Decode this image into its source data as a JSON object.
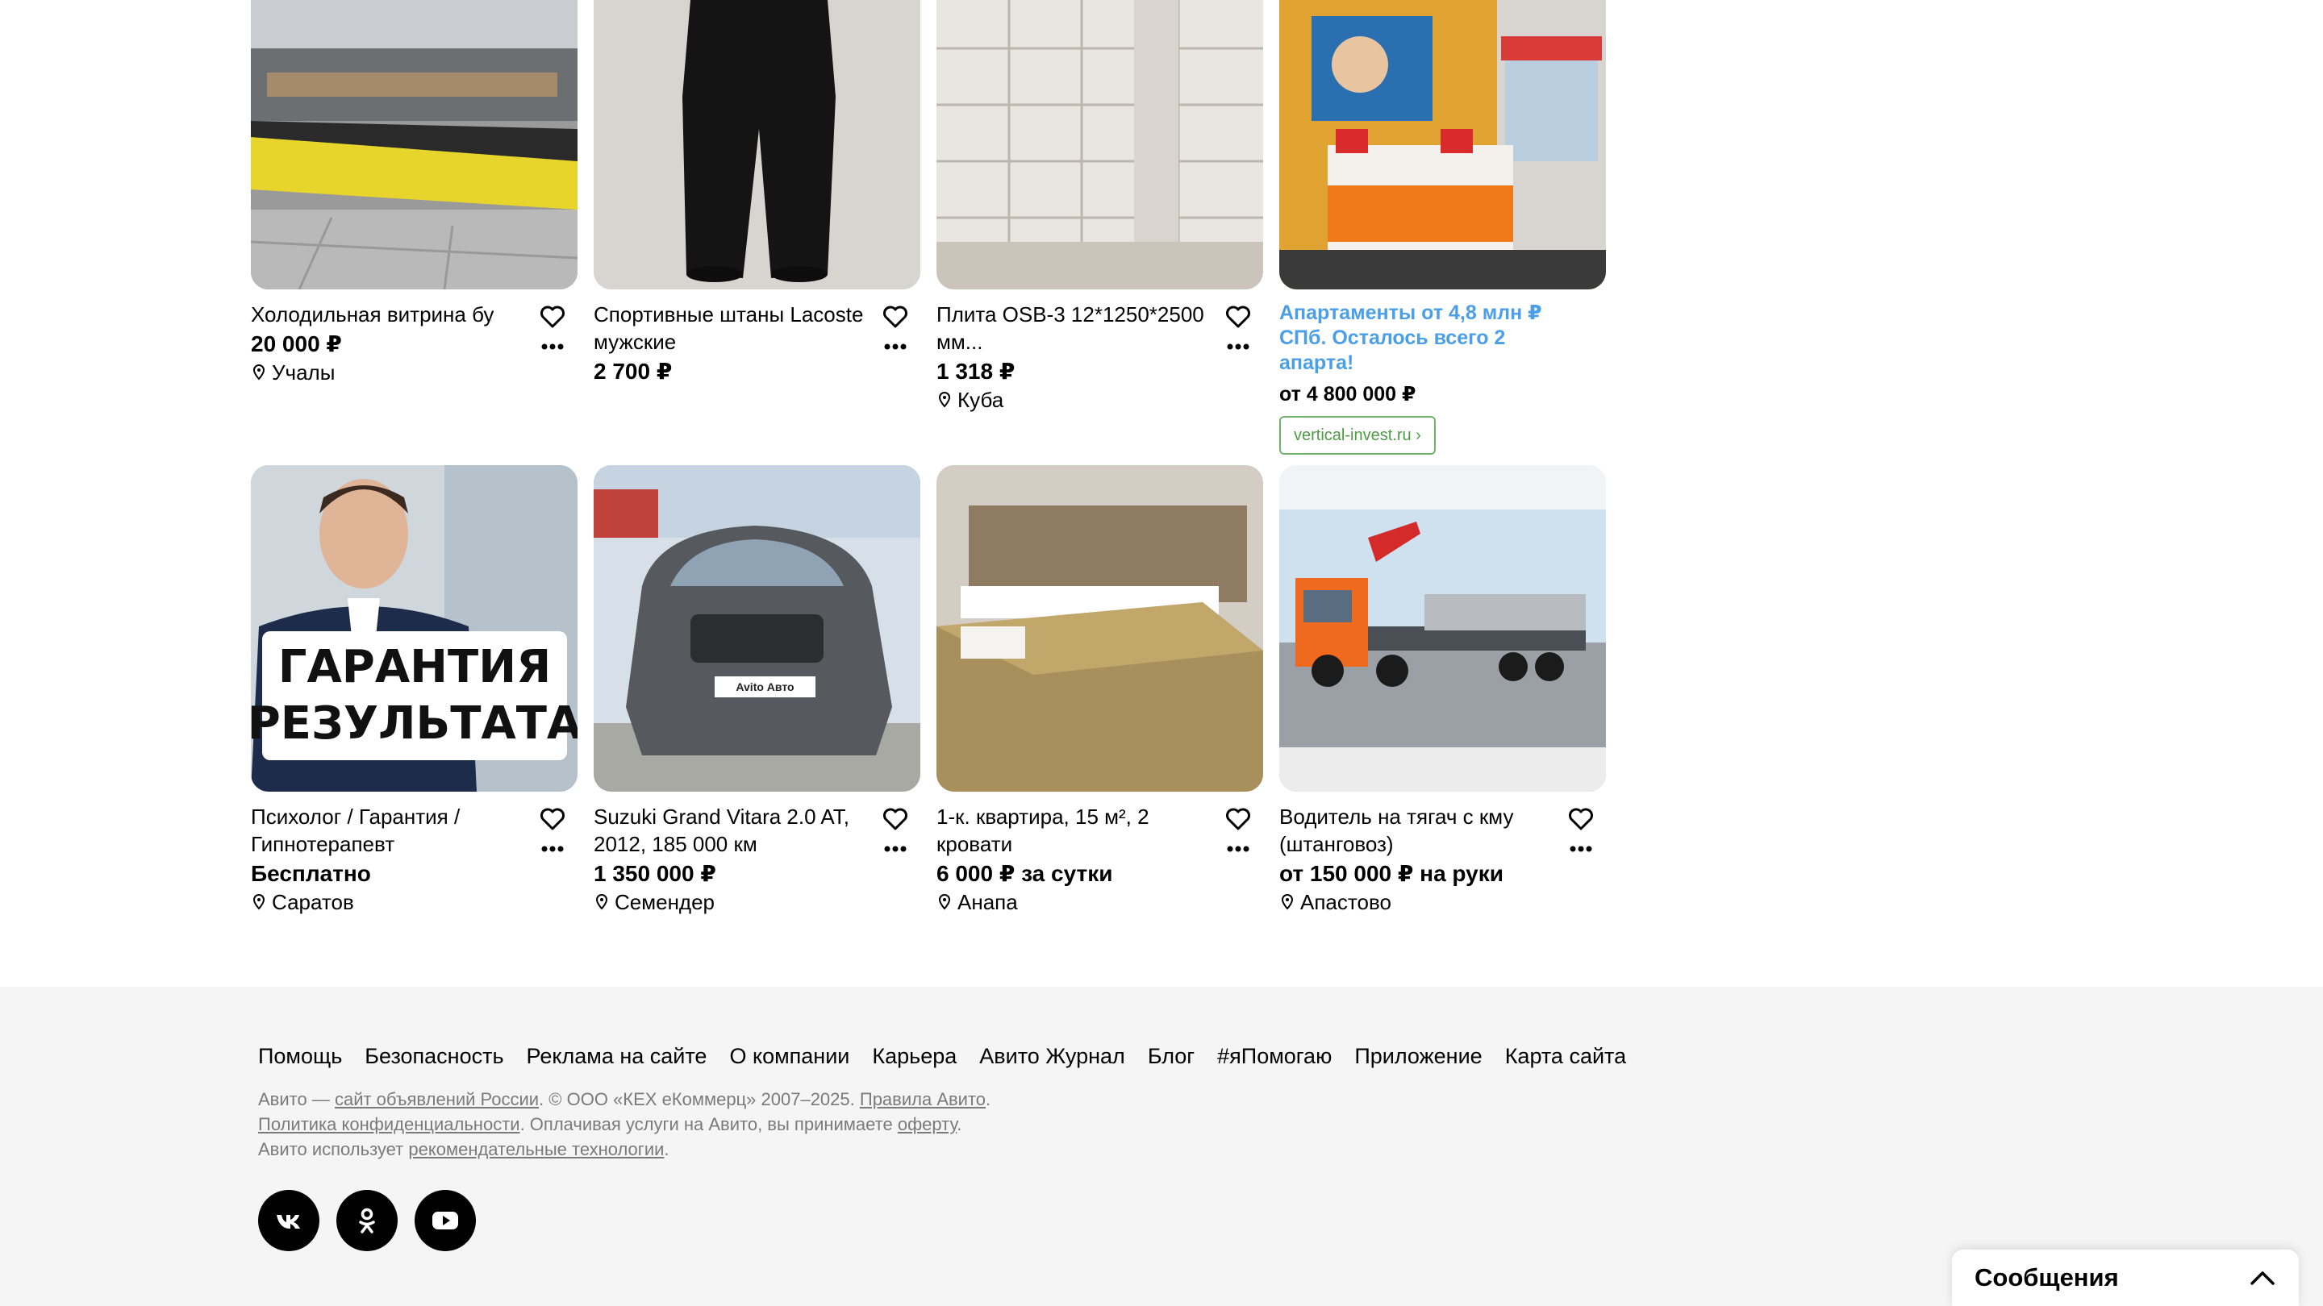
{
  "row1": [
    {
      "title": "Холодильная витрина бу",
      "price": "20 000 ₽",
      "location": "Учалы"
    },
    {
      "title": "Спортивные штаны Lacoste мужские",
      "price": "2 700 ₽",
      "location": ""
    },
    {
      "title": "Плита OSB-3 12*1250*2500 мм...",
      "price": "1 318 ₽",
      "location": "Куба"
    }
  ],
  "ad": {
    "title": "Апартаменты от 4,8 млн ₽ СПб. Осталось всего 2 апарта!",
    "price": "от 4 800 000 ₽",
    "link": "vertical-invest.ru ›"
  },
  "row2": [
    {
      "title": "Психолог / Гарантия / Гипнотерапевт",
      "price": "Бесплатно",
      "location": "Саратов",
      "image_text_line1": "ГАРАНТИЯ",
      "image_text_line2": "РЕЗУЛЬТАТА"
    },
    {
      "title": "Suzuki Grand Vitara 2.0 AT, 2012, 185 000 км",
      "price": "1 350 000 ₽",
      "location": "Семендер",
      "plate_text": "Avito Авто"
    },
    {
      "title": "1-к. квартира, 15 м², 2 кровати",
      "price": "6 000 ₽ за сутки",
      "location": "Анапа"
    },
    {
      "title": "Водитель на тягач с кму (штанговоз)",
      "price": "от 150 000 ₽ на руки",
      "location": "Апастово"
    }
  ],
  "footer": {
    "links": [
      "Помощь",
      "Безопасность",
      "Реклама на сайте",
      "О компании",
      "Карьера",
      "Авито Журнал",
      "Блог",
      "#яПомогаю",
      "Приложение",
      "Карта сайта"
    ],
    "legal": {
      "t1": "Авито — ",
      "l1": "сайт объявлений России",
      "t2": ". © ООО «КЕХ еКоммерц» 2007–2025. ",
      "l2": "Правила Авито",
      "t3": ".",
      "l3": "Политика конфиденциальности",
      "t4": ". Оплачивая услуги на Авито, вы принимаете ",
      "l4": "оферту",
      "t5": ".",
      "t6": "Авито использует ",
      "l5": "рекомендательные технологии",
      "t7": "."
    },
    "socials": [
      "vk-icon",
      "odnoklassniki-icon",
      "youtube-icon"
    ]
  },
  "messages": {
    "label": "Сообщения"
  },
  "colors": {
    "ad_title": "#4a9fe8",
    "ad_link": "#4e9a45",
    "footer_bg": "#f5f5f5"
  }
}
